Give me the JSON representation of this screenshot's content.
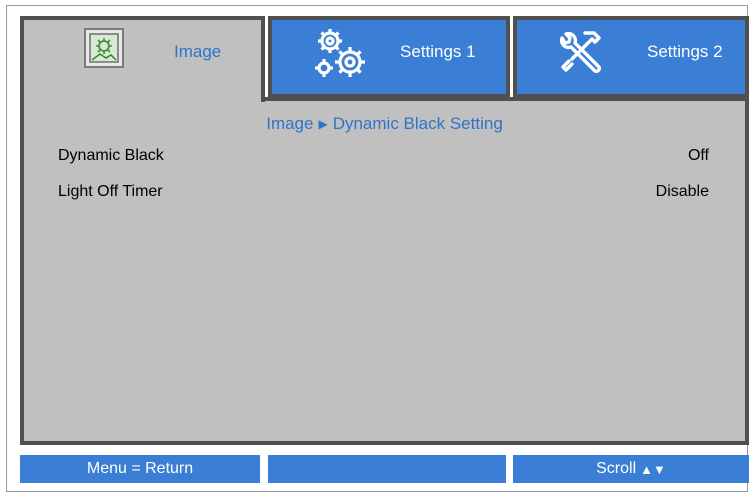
{
  "tabs": [
    {
      "label": "Image",
      "icon": "image-icon",
      "active": true
    },
    {
      "label": "Settings 1",
      "icon": "gears-icon",
      "active": false
    },
    {
      "label": "Settings 2",
      "icon": "tools-icon",
      "active": false
    }
  ],
  "breadcrumb": {
    "parent": "Image",
    "separator": "▶",
    "current": "Dynamic Black Setting"
  },
  "settings": [
    {
      "label": "Dynamic Black",
      "value": "Off"
    },
    {
      "label": "Light Off Timer",
      "value": "Disable"
    }
  ],
  "footer": {
    "left": "Menu = Return",
    "middle": "",
    "right": "Scroll",
    "right_arrows": "▲▼"
  },
  "colors": {
    "accent_blue": "#3a7ed6",
    "panel_gray": "#c0c0c0",
    "border_dark": "#505050",
    "active_text": "#2f74c8"
  }
}
